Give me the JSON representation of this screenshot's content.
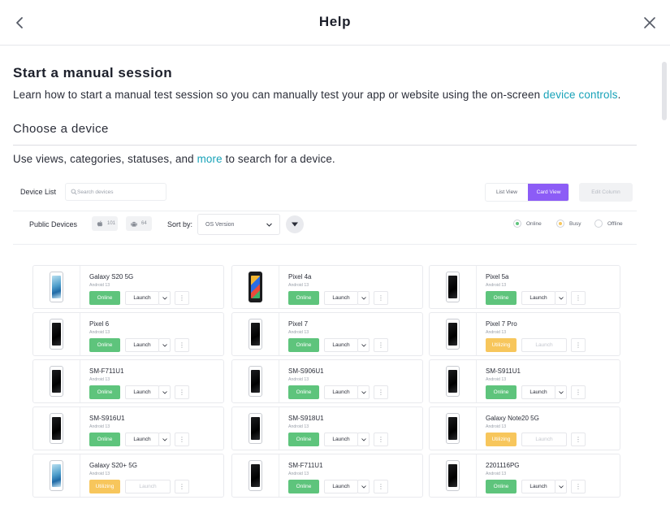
{
  "header": {
    "title": "Help",
    "back_icon": "chevron-left-icon",
    "close_icon": "close-icon"
  },
  "intro": {
    "title": "Start a manual session",
    "text_before_link": "Learn how to start a manual test session so you can manually test your app or website using the on-screen ",
    "link_text": "device controls",
    "text_after_link": "."
  },
  "choose": {
    "title": "Choose a device",
    "text_before_link": "Use views, categories, statuses, and ",
    "link_text": "more",
    "text_after_link": " to search for a device."
  },
  "device_list": {
    "label": "Device List",
    "search_placeholder": "Search devices",
    "list_view_label": "List View",
    "card_view_label": "Card View",
    "edit_column_label": "Edit Column",
    "public_devices_label": "Public Devices",
    "ios_count": "101",
    "android_count": "64",
    "sort_label": "Sort by:",
    "sort_value": "OS Version",
    "legend": {
      "online": "Online",
      "busy": "Busy",
      "offline": "Offline"
    },
    "colors": {
      "online": "#5ec47c",
      "busy": "#f7c65c",
      "accent": "#8c5cf6",
      "link": "#17a2b8"
    },
    "launch_label": "Launch",
    "devices": [
      {
        "name": "Galaxy S20 5G",
        "os": "Android 13",
        "status": "Online",
        "phone": "samsung"
      },
      {
        "name": "Pixel 4a",
        "os": "Android 13",
        "status": "Online",
        "phone": "pixel4a"
      },
      {
        "name": "Pixel 5a",
        "os": "Android 13",
        "status": "Online",
        "phone": "black"
      },
      {
        "name": "Pixel 6",
        "os": "Android 13",
        "status": "Online",
        "phone": "black"
      },
      {
        "name": "Pixel 7",
        "os": "Android 13",
        "status": "Online",
        "phone": "black"
      },
      {
        "name": "Pixel 7 Pro",
        "os": "Android 13",
        "status": "Utilizing",
        "phone": "black"
      },
      {
        "name": "SM-F711U1",
        "os": "Android 13",
        "status": "Online",
        "phone": "black"
      },
      {
        "name": "SM-S906U1",
        "os": "Android 13",
        "status": "Online",
        "phone": "black"
      },
      {
        "name": "SM-S911U1",
        "os": "Android 13",
        "status": "Online",
        "phone": "black"
      },
      {
        "name": "SM-S916U1",
        "os": "Android 13",
        "status": "Online",
        "phone": "black"
      },
      {
        "name": "SM-S918U1",
        "os": "Android 13",
        "status": "Online",
        "phone": "black"
      },
      {
        "name": "Galaxy Note20 5G",
        "os": "Android 13",
        "status": "Utilizing",
        "phone": "black"
      },
      {
        "name": "Galaxy S20+ 5G",
        "os": "Android 13",
        "status": "Utilizing",
        "phone": "samsung"
      },
      {
        "name": "SM-F711U1",
        "os": "Android 13",
        "status": "Online",
        "phone": "black"
      },
      {
        "name": "2201116PG",
        "os": "Android 13",
        "status": "Online",
        "phone": "black"
      }
    ]
  }
}
